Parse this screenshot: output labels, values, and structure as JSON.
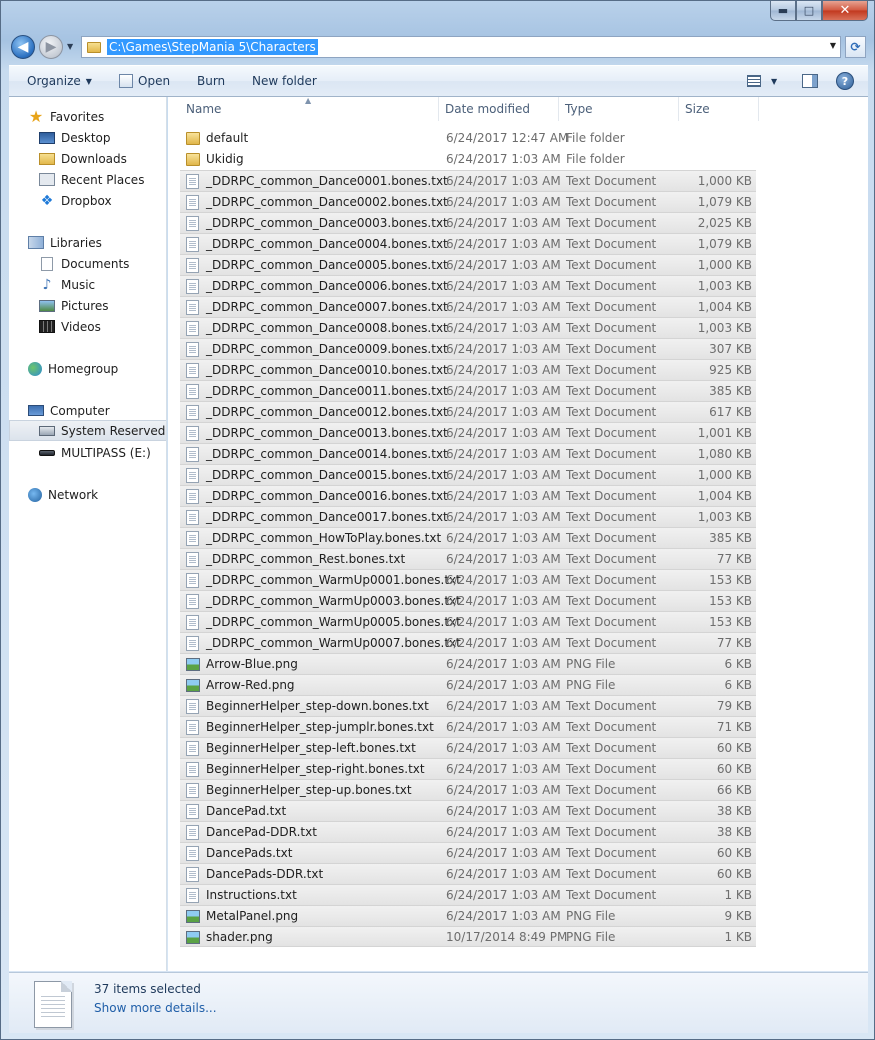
{
  "window": {
    "caption_min": "▬",
    "caption_max": "□",
    "caption_close": "✕"
  },
  "address": {
    "path": "C:\\Games\\StepMania 5\\Characters",
    "refresh_glyph": "⟳"
  },
  "toolbar": {
    "organize": "Organize",
    "open": "Open",
    "burn": "Burn",
    "new_folder": "New folder",
    "help_glyph": "?"
  },
  "nav": {
    "favorites": "Favorites",
    "desktop": "Desktop",
    "downloads": "Downloads",
    "recent_places": "Recent Places",
    "dropbox": "Dropbox",
    "libraries": "Libraries",
    "documents": "Documents",
    "music": "Music",
    "pictures": "Pictures",
    "videos": "Videos",
    "homegroup": "Homegroup",
    "computer": "Computer",
    "system_reserved": "System Reserved (C:",
    "multipass": "MULTIPASS (E:)",
    "network": "Network"
  },
  "columns": {
    "name": "Name",
    "date": "Date modified",
    "type": "Type",
    "size": "Size"
  },
  "files": [
    {
      "name": "default",
      "date": "6/24/2017 12:47 AM",
      "type": "File folder",
      "size": "",
      "kind": "folder",
      "selected": false
    },
    {
      "name": "Ukidig",
      "date": "6/24/2017 1:03 AM",
      "type": "File folder",
      "size": "",
      "kind": "folder",
      "selected": false
    },
    {
      "name": "_DDRPC_common_Dance0001.bones.txt",
      "date": "6/24/2017 1:03 AM",
      "type": "Text Document",
      "size": "1,000 KB",
      "kind": "txt",
      "selected": true
    },
    {
      "name": "_DDRPC_common_Dance0002.bones.txt",
      "date": "6/24/2017 1:03 AM",
      "type": "Text Document",
      "size": "1,079 KB",
      "kind": "txt",
      "selected": true
    },
    {
      "name": "_DDRPC_common_Dance0003.bones.txt",
      "date": "6/24/2017 1:03 AM",
      "type": "Text Document",
      "size": "2,025 KB",
      "kind": "txt",
      "selected": true
    },
    {
      "name": "_DDRPC_common_Dance0004.bones.txt",
      "date": "6/24/2017 1:03 AM",
      "type": "Text Document",
      "size": "1,079 KB",
      "kind": "txt",
      "selected": true
    },
    {
      "name": "_DDRPC_common_Dance0005.bones.txt",
      "date": "6/24/2017 1:03 AM",
      "type": "Text Document",
      "size": "1,000 KB",
      "kind": "txt",
      "selected": true
    },
    {
      "name": "_DDRPC_common_Dance0006.bones.txt",
      "date": "6/24/2017 1:03 AM",
      "type": "Text Document",
      "size": "1,003 KB",
      "kind": "txt",
      "selected": true
    },
    {
      "name": "_DDRPC_common_Dance0007.bones.txt",
      "date": "6/24/2017 1:03 AM",
      "type": "Text Document",
      "size": "1,004 KB",
      "kind": "txt",
      "selected": true
    },
    {
      "name": "_DDRPC_common_Dance0008.bones.txt",
      "date": "6/24/2017 1:03 AM",
      "type": "Text Document",
      "size": "1,003 KB",
      "kind": "txt",
      "selected": true
    },
    {
      "name": "_DDRPC_common_Dance0009.bones.txt",
      "date": "6/24/2017 1:03 AM",
      "type": "Text Document",
      "size": "307 KB",
      "kind": "txt",
      "selected": true
    },
    {
      "name": "_DDRPC_common_Dance0010.bones.txt",
      "date": "6/24/2017 1:03 AM",
      "type": "Text Document",
      "size": "925 KB",
      "kind": "txt",
      "selected": true
    },
    {
      "name": "_DDRPC_common_Dance0011.bones.txt",
      "date": "6/24/2017 1:03 AM",
      "type": "Text Document",
      "size": "385 KB",
      "kind": "txt",
      "selected": true
    },
    {
      "name": "_DDRPC_common_Dance0012.bones.txt",
      "date": "6/24/2017 1:03 AM",
      "type": "Text Document",
      "size": "617 KB",
      "kind": "txt",
      "selected": true
    },
    {
      "name": "_DDRPC_common_Dance0013.bones.txt",
      "date": "6/24/2017 1:03 AM",
      "type": "Text Document",
      "size": "1,001 KB",
      "kind": "txt",
      "selected": true
    },
    {
      "name": "_DDRPC_common_Dance0014.bones.txt",
      "date": "6/24/2017 1:03 AM",
      "type": "Text Document",
      "size": "1,080 KB",
      "kind": "txt",
      "selected": true
    },
    {
      "name": "_DDRPC_common_Dance0015.bones.txt",
      "date": "6/24/2017 1:03 AM",
      "type": "Text Document",
      "size": "1,000 KB",
      "kind": "txt",
      "selected": true
    },
    {
      "name": "_DDRPC_common_Dance0016.bones.txt",
      "date": "6/24/2017 1:03 AM",
      "type": "Text Document",
      "size": "1,004 KB",
      "kind": "txt",
      "selected": true
    },
    {
      "name": "_DDRPC_common_Dance0017.bones.txt",
      "date": "6/24/2017 1:03 AM",
      "type": "Text Document",
      "size": "1,003 KB",
      "kind": "txt",
      "selected": true
    },
    {
      "name": "_DDRPC_common_HowToPlay.bones.txt",
      "date": "6/24/2017 1:03 AM",
      "type": "Text Document",
      "size": "385 KB",
      "kind": "txt",
      "selected": true
    },
    {
      "name": "_DDRPC_common_Rest.bones.txt",
      "date": "6/24/2017 1:03 AM",
      "type": "Text Document",
      "size": "77 KB",
      "kind": "txt",
      "selected": true
    },
    {
      "name": "_DDRPC_common_WarmUp0001.bones.txt",
      "date": "6/24/2017 1:03 AM",
      "type": "Text Document",
      "size": "153 KB",
      "kind": "txt",
      "selected": true
    },
    {
      "name": "_DDRPC_common_WarmUp0003.bones.txt",
      "date": "6/24/2017 1:03 AM",
      "type": "Text Document",
      "size": "153 KB",
      "kind": "txt",
      "selected": true
    },
    {
      "name": "_DDRPC_common_WarmUp0005.bones.txt",
      "date": "6/24/2017 1:03 AM",
      "type": "Text Document",
      "size": "153 KB",
      "kind": "txt",
      "selected": true
    },
    {
      "name": "_DDRPC_common_WarmUp0007.bones.txt",
      "date": "6/24/2017 1:03 AM",
      "type": "Text Document",
      "size": "77 KB",
      "kind": "txt",
      "selected": true
    },
    {
      "name": "Arrow-Blue.png",
      "date": "6/24/2017 1:03 AM",
      "type": "PNG File",
      "size": "6 KB",
      "kind": "png",
      "selected": true
    },
    {
      "name": "Arrow-Red.png",
      "date": "6/24/2017 1:03 AM",
      "type": "PNG File",
      "size": "6 KB",
      "kind": "png",
      "selected": true
    },
    {
      "name": "BeginnerHelper_step-down.bones.txt",
      "date": "6/24/2017 1:03 AM",
      "type": "Text Document",
      "size": "79 KB",
      "kind": "txt",
      "selected": true
    },
    {
      "name": "BeginnerHelper_step-jumplr.bones.txt",
      "date": "6/24/2017 1:03 AM",
      "type": "Text Document",
      "size": "71 KB",
      "kind": "txt",
      "selected": true
    },
    {
      "name": "BeginnerHelper_step-left.bones.txt",
      "date": "6/24/2017 1:03 AM",
      "type": "Text Document",
      "size": "60 KB",
      "kind": "txt",
      "selected": true
    },
    {
      "name": "BeginnerHelper_step-right.bones.txt",
      "date": "6/24/2017 1:03 AM",
      "type": "Text Document",
      "size": "60 KB",
      "kind": "txt",
      "selected": true
    },
    {
      "name": "BeginnerHelper_step-up.bones.txt",
      "date": "6/24/2017 1:03 AM",
      "type": "Text Document",
      "size": "66 KB",
      "kind": "txt",
      "selected": true
    },
    {
      "name": "DancePad.txt",
      "date": "6/24/2017 1:03 AM",
      "type": "Text Document",
      "size": "38 KB",
      "kind": "txt",
      "selected": true
    },
    {
      "name": "DancePad-DDR.txt",
      "date": "6/24/2017 1:03 AM",
      "type": "Text Document",
      "size": "38 KB",
      "kind": "txt",
      "selected": true
    },
    {
      "name": "DancePads.txt",
      "date": "6/24/2017 1:03 AM",
      "type": "Text Document",
      "size": "60 KB",
      "kind": "txt",
      "selected": true
    },
    {
      "name": "DancePads-DDR.txt",
      "date": "6/24/2017 1:03 AM",
      "type": "Text Document",
      "size": "60 KB",
      "kind": "txt",
      "selected": true
    },
    {
      "name": "Instructions.txt",
      "date": "6/24/2017 1:03 AM",
      "type": "Text Document",
      "size": "1 KB",
      "kind": "txt",
      "selected": true
    },
    {
      "name": "MetalPanel.png",
      "date": "6/24/2017 1:03 AM",
      "type": "PNG File",
      "size": "9 KB",
      "kind": "png",
      "selected": true
    },
    {
      "name": "shader.png",
      "date": "10/17/2014 8:49 PM",
      "type": "PNG File",
      "size": "1 KB",
      "kind": "png",
      "selected": true
    }
  ],
  "details": {
    "count": "37 items selected",
    "more": "Show more details..."
  }
}
